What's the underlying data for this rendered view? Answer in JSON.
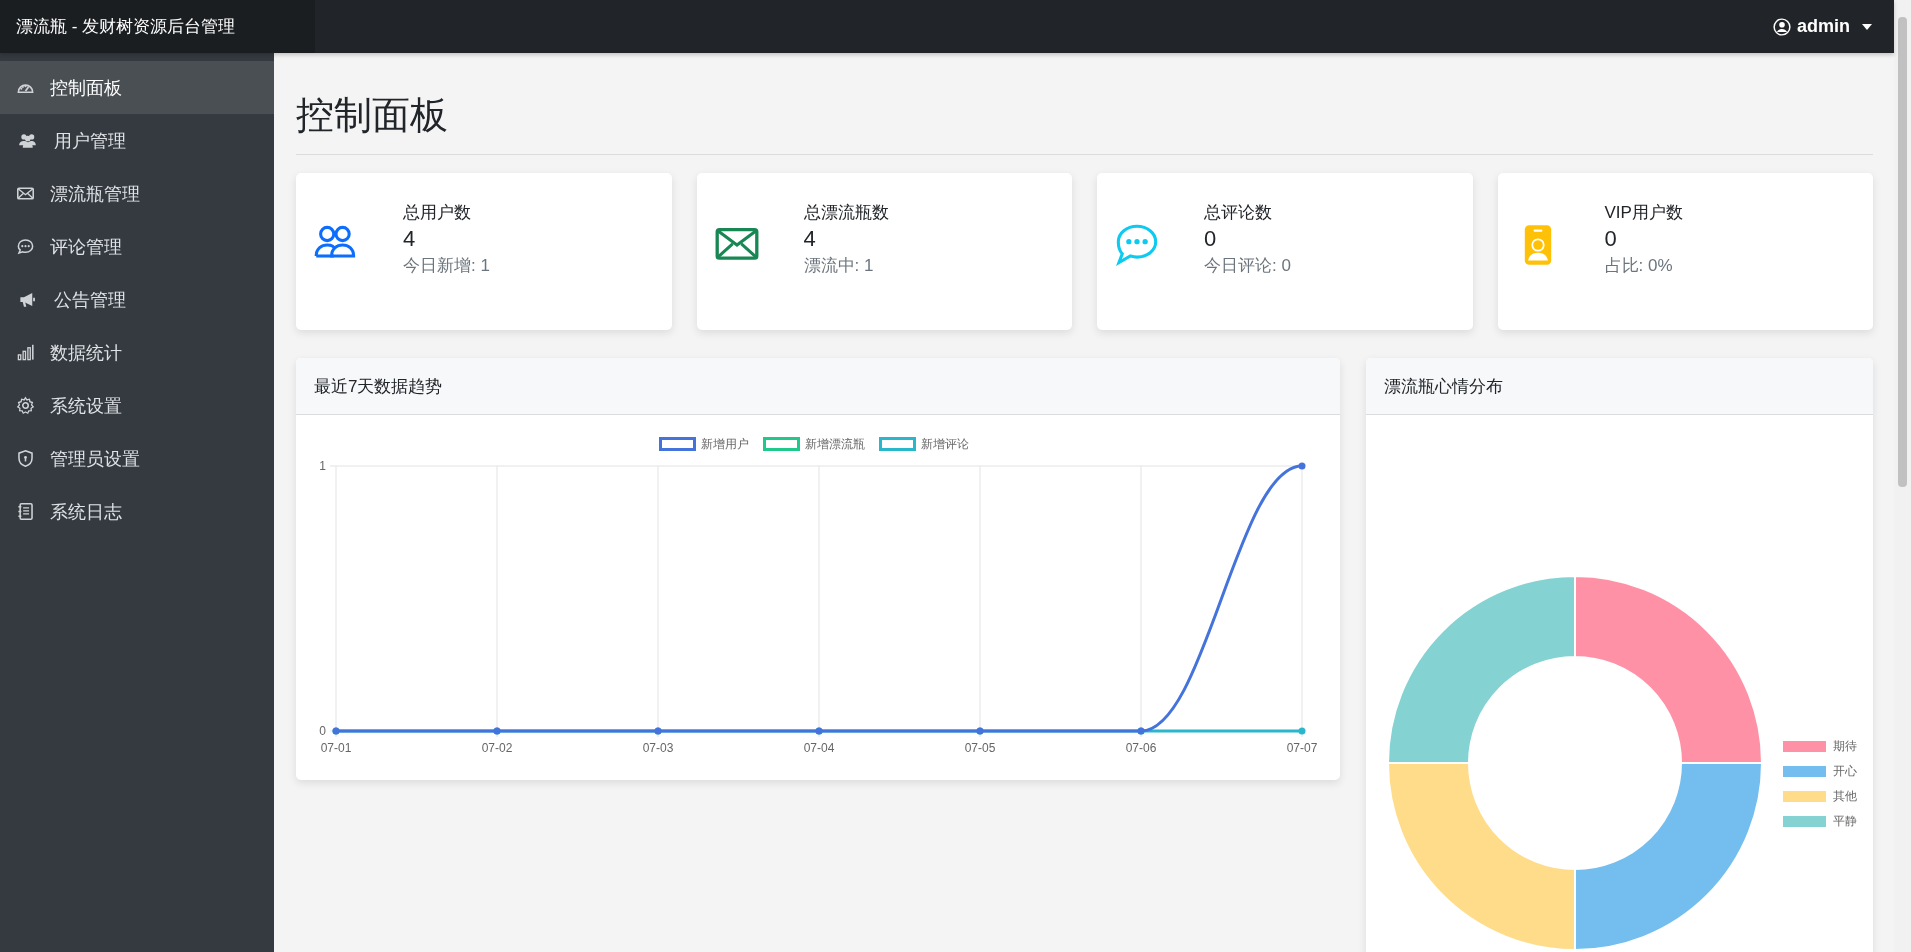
{
  "topbar": {
    "brand": "漂流瓶 - 发财树资源后台管理",
    "user": "admin"
  },
  "sidebar": {
    "items": [
      {
        "label": "控制面板",
        "selected": true
      },
      {
        "label": "用户管理",
        "selected": false
      },
      {
        "label": "漂流瓶管理",
        "selected": false
      },
      {
        "label": "评论管理",
        "selected": false
      },
      {
        "label": "公告管理",
        "selected": false
      },
      {
        "label": "数据统计",
        "selected": false
      },
      {
        "label": "系统设置",
        "selected": false
      },
      {
        "label": "管理员设置",
        "selected": false
      },
      {
        "label": "系统日志",
        "selected": false
      }
    ]
  },
  "page_title": "控制面板",
  "stats": [
    {
      "title": "总用户数",
      "value": "4",
      "note": "今日新增: 1"
    },
    {
      "title": "总漂流瓶数",
      "value": "4",
      "note": "漂流中: 1"
    },
    {
      "title": "总评论数",
      "value": "0",
      "note": "今日评论: 0"
    },
    {
      "title": "VIP用户数",
      "value": "0",
      "note": "占比: 0%"
    }
  ],
  "trend_panel": {
    "title": "最近7天数据趋势",
    "chart_data": {
      "type": "line",
      "categories": [
        "07-01",
        "07-02",
        "07-03",
        "07-04",
        "07-05",
        "07-06",
        "07-07"
      ],
      "ylim": [
        0,
        1
      ],
      "yticks": [
        0,
        1
      ],
      "grid": true,
      "legend": true,
      "series": [
        {
          "name": "新增用户",
          "color": "#4373db",
          "marker": true,
          "values": [
            0,
            0,
            0,
            0,
            0,
            0,
            1
          ]
        },
        {
          "name": "新增漂流瓶",
          "color": "#20c98b",
          "values": [
            null,
            null,
            null,
            null,
            null,
            null,
            null
          ]
        },
        {
          "name": "新增评论",
          "color": "#2ab6cb",
          "marker": true,
          "values": [
            0,
            0,
            0,
            0,
            0,
            0,
            0
          ]
        }
      ]
    }
  },
  "mood_panel": {
    "title": "漂流瓶心情分布",
    "chart_data": {
      "type": "donut",
      "categories": [
        "期待",
        "开心",
        "其他",
        "平静"
      ],
      "values": [
        25,
        25,
        25,
        25
      ],
      "colors": [
        "#ff91a6",
        "#74bdef",
        "#ffdc89",
        "#84d2d2"
      ],
      "legend": true
    }
  }
}
